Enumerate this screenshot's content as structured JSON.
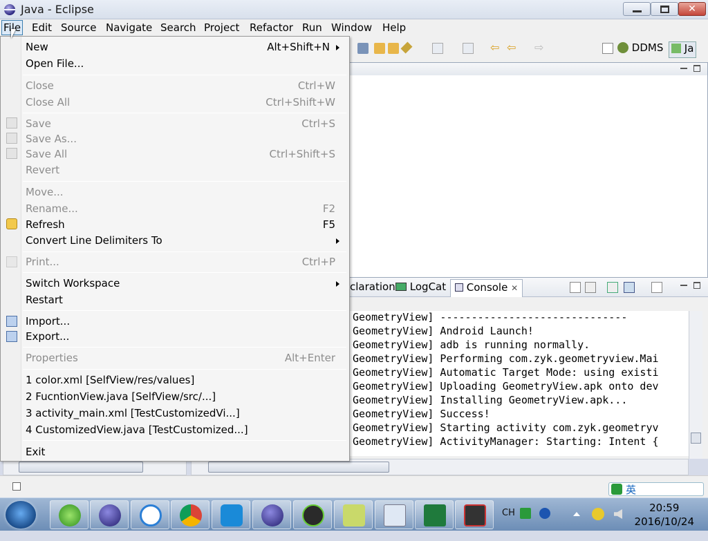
{
  "window": {
    "title": "Java - Eclipse"
  },
  "menubar": {
    "items": [
      {
        "label": "File",
        "mnemonic": "F",
        "rest": "ile"
      },
      {
        "label": "Edit",
        "mnemonic": "E",
        "rest": "dit"
      },
      {
        "label": "Source",
        "mnemonic": "S",
        "rest": "ource"
      },
      {
        "label": "Navigate",
        "mnemonic": "N",
        "rest": "avigate"
      },
      {
        "label": "Search",
        "mnemonic": "a",
        "pre": "Se",
        "rest": "rch"
      },
      {
        "label": "Project",
        "mnemonic": "P",
        "rest": "roject"
      },
      {
        "label": "Refactor",
        "mnemonic": "t",
        "pre": "Refac",
        "rest": "or"
      },
      {
        "label": "Run",
        "mnemonic": "R",
        "rest": "un"
      },
      {
        "label": "Window",
        "mnemonic": "W",
        "rest": "indow"
      },
      {
        "label": "Help",
        "mnemonic": "H",
        "rest": "elp"
      }
    ]
  },
  "file_menu": {
    "items": [
      {
        "label": "New",
        "accel": "Alt+Shift+N",
        "submenu": true,
        "enabled": true
      },
      {
        "label": "Open File...",
        "accel": "",
        "enabled": true
      },
      {
        "label": "Close",
        "accel": "Ctrl+W",
        "enabled": false
      },
      {
        "label": "Close All",
        "accel": "Ctrl+Shift+W",
        "enabled": false
      },
      {
        "label": "Save",
        "accel": "Ctrl+S",
        "enabled": false
      },
      {
        "label": "Save As...",
        "accel": "",
        "enabled": false
      },
      {
        "label": "Save All",
        "accel": "Ctrl+Shift+S",
        "enabled": false
      },
      {
        "label": "Revert",
        "accel": "",
        "enabled": false
      },
      {
        "label": "Move...",
        "accel": "",
        "enabled": false
      },
      {
        "label": "Rename...",
        "accel": "F2",
        "enabled": false
      },
      {
        "label": "Refresh",
        "accel": "F5",
        "enabled": true
      },
      {
        "label": "Convert Line Delimiters To",
        "accel": "",
        "submenu": true,
        "enabled": true
      },
      {
        "label": "Print...",
        "accel": "Ctrl+P",
        "enabled": false
      },
      {
        "label": "Switch Workspace",
        "accel": "",
        "submenu": true,
        "enabled": true
      },
      {
        "label": "Restart",
        "accel": "",
        "enabled": true
      },
      {
        "label": "Import...",
        "accel": "",
        "enabled": true
      },
      {
        "label": "Export...",
        "accel": "",
        "enabled": true
      },
      {
        "label": "Properties",
        "accel": "Alt+Enter",
        "enabled": false
      },
      {
        "label": "1 color.xml  [SelfView/res/values]",
        "accel": "",
        "enabled": true
      },
      {
        "label": "2 FucntionView.java  [SelfView/src/...]",
        "accel": "",
        "enabled": true
      },
      {
        "label": "3 activity_main.xml  [TestCustomizedVi...]",
        "accel": "",
        "enabled": true
      },
      {
        "label": "4 CustomizedView.java  [TestCustomized...]",
        "accel": "",
        "enabled": true
      },
      {
        "label": "Exit",
        "accel": "",
        "enabled": true
      }
    ]
  },
  "toolbar": {
    "perspective_ddms": "DDMS",
    "perspective_java": "Ja"
  },
  "panel": {
    "tabs": [
      {
        "label": "claration",
        "active": false
      },
      {
        "label": "LogCat",
        "active": false
      },
      {
        "label": "Console",
        "active": true
      }
    ]
  },
  "console": {
    "lines": [
      "GeometryView] ------------------------------",
      "GeometryView] Android Launch!",
      "GeometryView] adb is running normally.",
      "GeometryView] Performing com.zyk.geometryview.Mai",
      "GeometryView] Automatic Target Mode: using existi",
      "GeometryView] Uploading GeometryView.apk onto dev",
      "GeometryView] Installing GeometryView.apk...",
      "GeometryView] Success!",
      "GeometryView] Starting activity com.zyk.geometryv",
      "GeometryView] ActivityManager: Starting: Intent {"
    ]
  },
  "taskbar": {
    "lang": "CH",
    "time": "20:59",
    "date": "2016/10/24",
    "ime_label": "英"
  },
  "colors": {
    "menu_highlight": "#dbe9f7",
    "disabled_text": "#8d8d8d",
    "close_button": "#c4463a"
  }
}
